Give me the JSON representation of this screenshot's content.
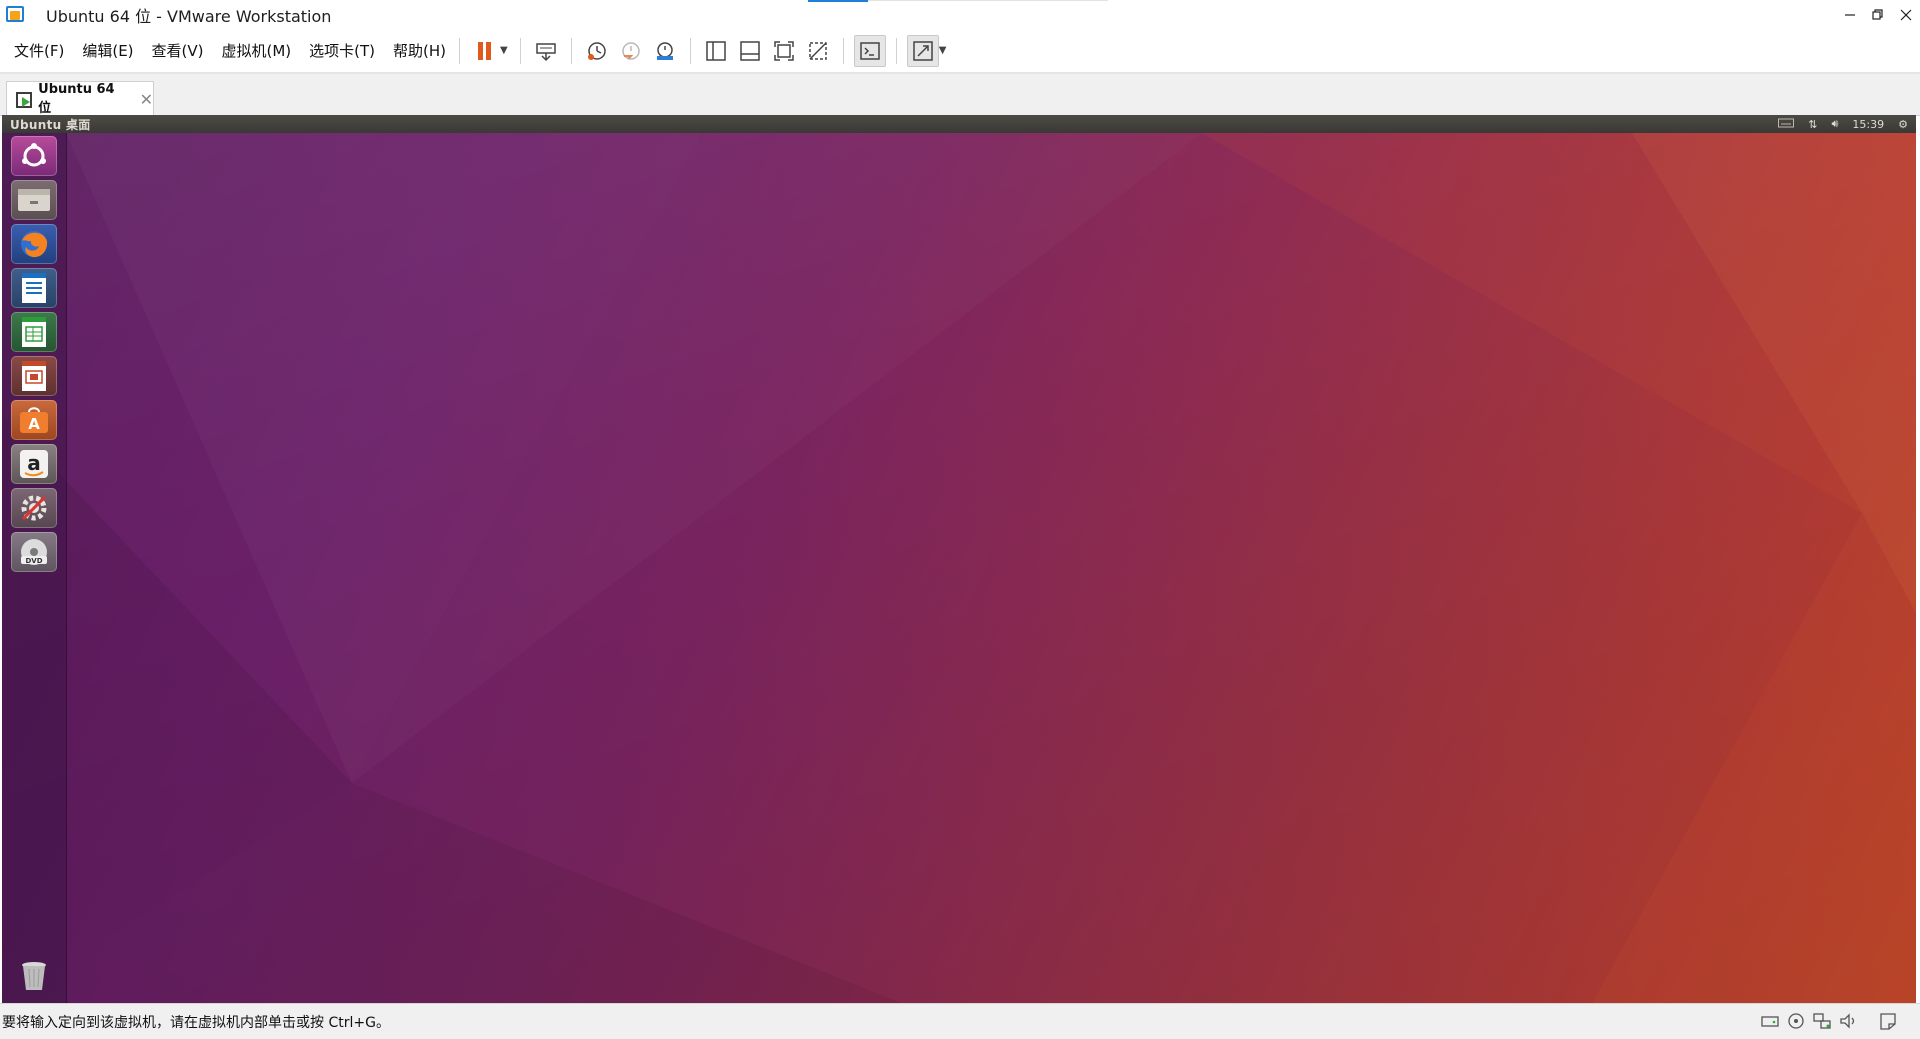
{
  "window": {
    "title": "Ubuntu 64 位 - VMware Workstation",
    "controls": [
      "minimize",
      "restore",
      "close"
    ]
  },
  "menu": {
    "items": [
      "文件(F)",
      "编辑(E)",
      "查看(V)",
      "虚拟机(M)",
      "选项卡(T)",
      "帮助(H)"
    ]
  },
  "toolbar": {
    "buttons": [
      "pause-icon",
      "send-ctrl-alt-del-icon",
      "snapshot-take-icon",
      "snapshot-revert-icon",
      "snapshot-manager-icon",
      "library-view-icon",
      "thumbnail-bar-icon",
      "fit-guest-icon",
      "unity-icon",
      "console-view-icon",
      "full-screen-icon"
    ],
    "accent_color": "#e05a1e"
  },
  "tab": {
    "label": "Ubuntu 64 位"
  },
  "guest": {
    "panel_title": "Ubuntu 桌面",
    "clock": "15:39",
    "launcher": [
      "dash-icon",
      "files-icon",
      "firefox-icon",
      "writer-icon",
      "calc-icon",
      "impress-icon",
      "software-center-icon",
      "amazon-icon",
      "system-settings-icon",
      "dvd-icon",
      "trash-icon"
    ],
    "wallpaper_colors": [
      "#5a1a5e",
      "#8e2b53",
      "#cc4a2c"
    ]
  },
  "status": {
    "message": "要将输入定向到该虚拟机，请在虚拟机内部单击或按 Ctrl+G。"
  }
}
